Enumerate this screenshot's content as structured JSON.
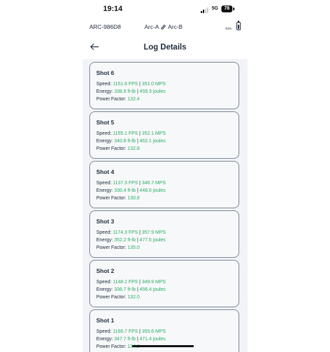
{
  "status_bar": {
    "time": "19:14",
    "network": "5G",
    "battery": "78"
  },
  "device": {
    "id": "ARC-986D8",
    "pair_left": "Arc-A",
    "pair_right": "Arc-B",
    "battery_pct": "80%",
    "battery_level": 0.8
  },
  "header": {
    "title": "Log Details",
    "back_icon": "arrow-left-icon"
  },
  "labels": {
    "speed": "Speed:",
    "energy": "Energy:",
    "power_factor": "Power Factor:",
    "separator": "|"
  },
  "colors": {
    "value": "#27ae60",
    "text": "#1e2a3a",
    "card_border": "#7b8593",
    "background": "#f1f3f6"
  },
  "shots": [
    {
      "title": "Shot 6",
      "fps": "1151.6 FPS",
      "mps": "351.0 MPS",
      "ftlb": "338.8 ft-lb",
      "joules": "459.3 joules",
      "pf": "132.4"
    },
    {
      "title": "Shot 5",
      "fps": "1155.1 FPS",
      "mps": "352.1 MPS",
      "ftlb": "340.8 ft-lb",
      "joules": "462.1 joules",
      "pf": "132.8"
    },
    {
      "title": "Shot 4",
      "fps": "1137.3 FPS",
      "mps": "346.7 MPS",
      "ftlb": "330.4 ft-lb",
      "joules": "448.0 joules",
      "pf": "130.8"
    },
    {
      "title": "Shot 3",
      "fps": "1174.3 FPS",
      "mps": "357.9 MPS",
      "ftlb": "352.2 ft-lb",
      "joules": "477.5 joules",
      "pf": "135.0"
    },
    {
      "title": "Shot 2",
      "fps": "1148.1 FPS",
      "mps": "349.9 MPS",
      "ftlb": "336.7 ft-lb",
      "joules": "456.4 joules",
      "pf": "132.0"
    },
    {
      "title": "Shot 1",
      "fps": "1166.7 FPS",
      "mps": "355.6 MPS",
      "ftlb": "347.7 ft-lb",
      "joules": "471.4 joules",
      "pf": "134.3"
    }
  ]
}
